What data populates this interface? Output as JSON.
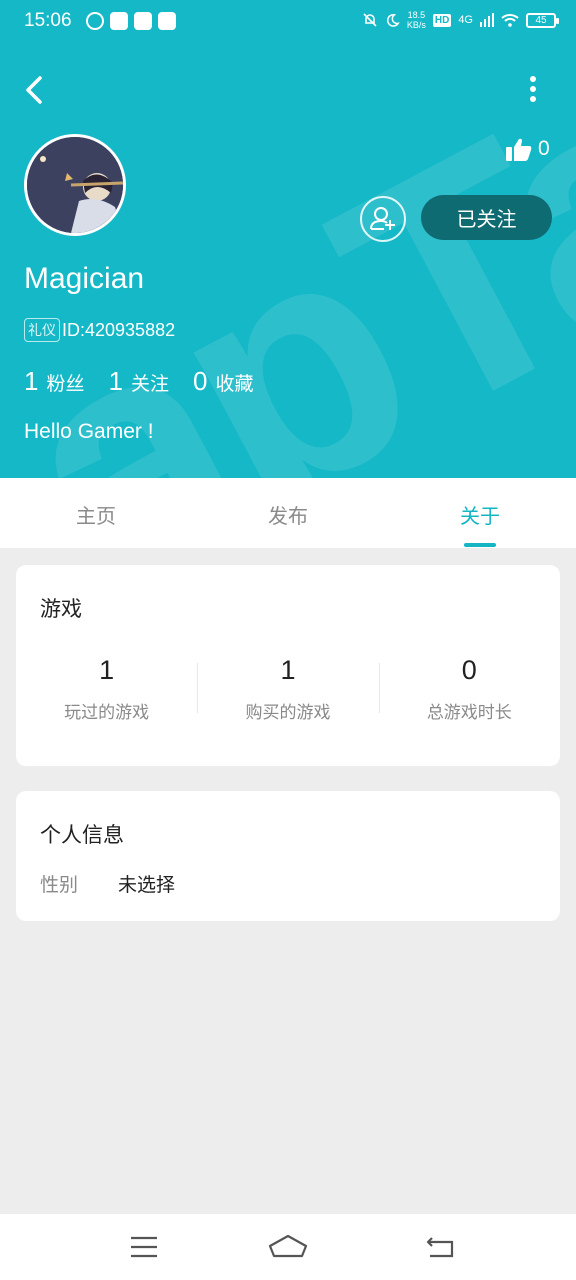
{
  "status_bar": {
    "time": "15:06",
    "net_speed_value": "18.5",
    "net_speed_unit": "KB/s",
    "hd_label": "HD",
    "network": "4G",
    "battery": "45"
  },
  "profile": {
    "likes": "0",
    "follow_button": "已关注",
    "username": "Magician",
    "tag": "礼仪",
    "id_text": "ID:420935882",
    "stats": [
      {
        "value": "1",
        "label": "粉丝"
      },
      {
        "value": "1",
        "label": "关注"
      },
      {
        "value": "0",
        "label": "收藏"
      }
    ],
    "bio": "Hello Gamer !"
  },
  "tabs": [
    {
      "label": "主页",
      "active": false
    },
    {
      "label": "发布",
      "active": false
    },
    {
      "label": "关于",
      "active": true
    }
  ],
  "games_card": {
    "title": "游戏",
    "stats": [
      {
        "value": "1",
        "label": "玩过的游戏"
      },
      {
        "value": "1",
        "label": "购买的游戏"
      },
      {
        "value": "0",
        "label": "总游戏时长"
      }
    ]
  },
  "info_card": {
    "title": "个人信息",
    "rows": [
      {
        "label": "性别",
        "value": "未选择"
      }
    ]
  },
  "colors": {
    "header": "#15b8c7",
    "accent": "#16b5c4",
    "follow_button": "#0f6b72",
    "page_bg": "#ededed"
  },
  "icons": [
    "back-icon",
    "more-icon",
    "thumb-up-icon",
    "add-friend-icon",
    "menu-icon",
    "home-icon",
    "return-icon"
  ]
}
